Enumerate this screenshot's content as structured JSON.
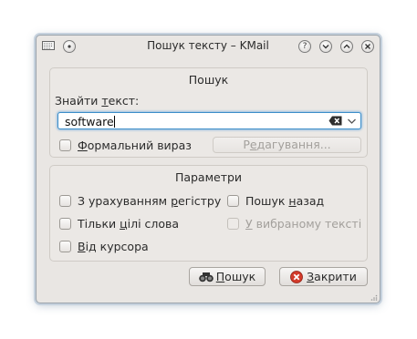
{
  "window": {
    "title": "Пошук тексту – KMail"
  },
  "find_group": {
    "title": "Пошук",
    "find_label_pre": "Знайти ",
    "find_label_accel": "т",
    "find_label_post": "екст:",
    "search_value": "software",
    "regex_label_accel": "Ф",
    "regex_label_post": "ормальний вираз",
    "edit_button_pre": "Р",
    "edit_button_accel": "е",
    "edit_button_post": "дагування..."
  },
  "options_group": {
    "title": "Параметри",
    "case_pre": "З урахуванням ",
    "case_accel": "р",
    "case_post": "егістру",
    "whole_pre": "Тільки ",
    "whole_accel": "ц",
    "whole_post": "ілі слова",
    "from_cursor_accel": "В",
    "from_cursor_post": "ід курсора",
    "backwards_pre": "Пошук ",
    "backwards_accel": "н",
    "backwards_post": "азад",
    "selected_accel": "У",
    "selected_post": " вибраному тексті"
  },
  "buttons": {
    "search_accel": "П",
    "search_post": "ошук",
    "close_accel": "З",
    "close_post": "акрити"
  },
  "icons": {
    "window_menu": "window-menu-icon",
    "pin": "pin-icon",
    "help": "help-icon",
    "minimize": "minimize-icon",
    "maximize": "maximize-icon",
    "close": "close-icon",
    "clear_text": "clear-text-icon",
    "dropdown": "chevron-down-icon",
    "binoculars": "binoculars-icon",
    "close_red": "close-circle-icon"
  },
  "colors": {
    "focus_border": "#3c8ec9",
    "close_red": "#d23a2a"
  },
  "checkbox_states": {
    "regex": false,
    "case_sensitive": false,
    "whole_words": false,
    "from_cursor": false,
    "backwards": false,
    "selected_text": false
  }
}
